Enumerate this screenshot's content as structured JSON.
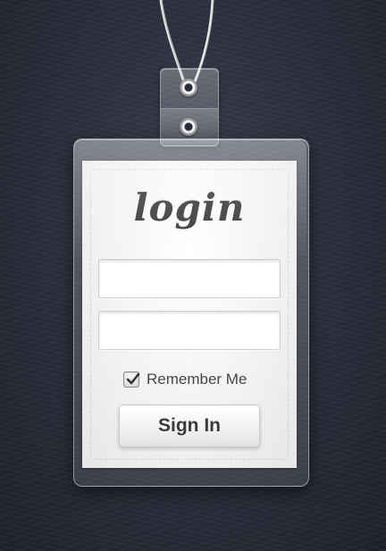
{
  "card": {
    "title": "login",
    "username_placeholder": "",
    "password_placeholder": "",
    "remember_label": "Remember Me",
    "remember_checked": true,
    "signin_label": "Sign In"
  },
  "icons": {
    "checkbox": "checkmark-icon",
    "clip": "badge-clip-icon",
    "lanyard": "lanyard-cord"
  },
  "colors": {
    "background": "#2a2e3b",
    "card": "#f1f1f1",
    "text": "#3a3a3a"
  }
}
